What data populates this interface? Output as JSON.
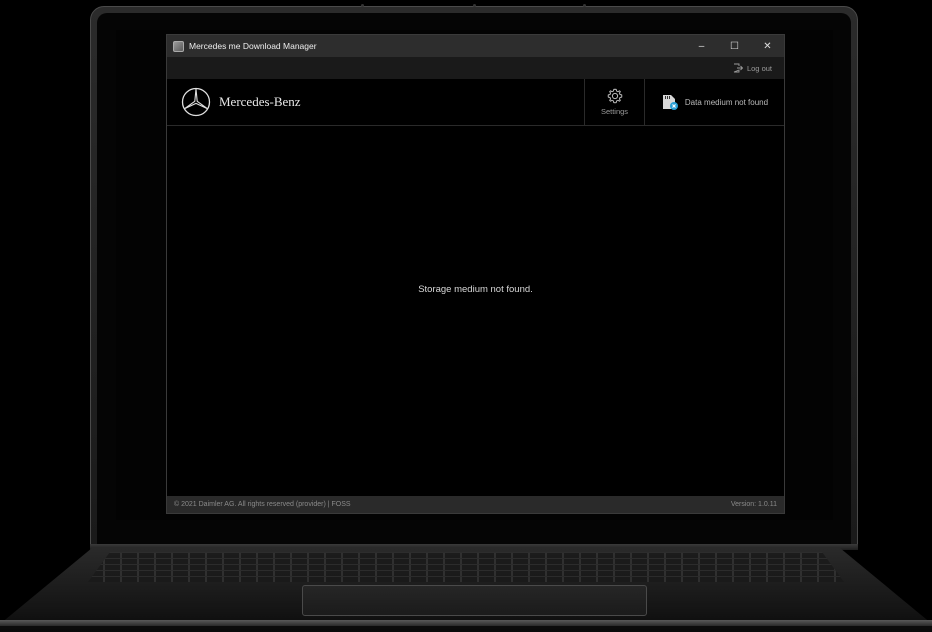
{
  "window": {
    "title": "Mercedes me Download Manager",
    "minimize": "–",
    "maximize": "☐",
    "close": "✕"
  },
  "subbar": {
    "logout_label": "Log out"
  },
  "header": {
    "brand_name": "Mercedes-Benz",
    "settings_label": "Settings",
    "medium_status": "Data medium not found"
  },
  "main": {
    "message": "Storage medium not found."
  },
  "footer": {
    "copyright": "© 2021 Daimler AG. All rights reserved (provider)  |  FOSS",
    "version": "Version: 1.0.11"
  },
  "icons": {
    "app": "app-icon",
    "logout": "logout-icon",
    "logo": "mercedes-star-icon",
    "settings": "gear-icon",
    "medium": "sd-card-icon"
  },
  "colors": {
    "background": "#000000",
    "titlebar": "#2d2d2d",
    "footer": "#2a2a2a",
    "accent": "#2a9fd6"
  }
}
